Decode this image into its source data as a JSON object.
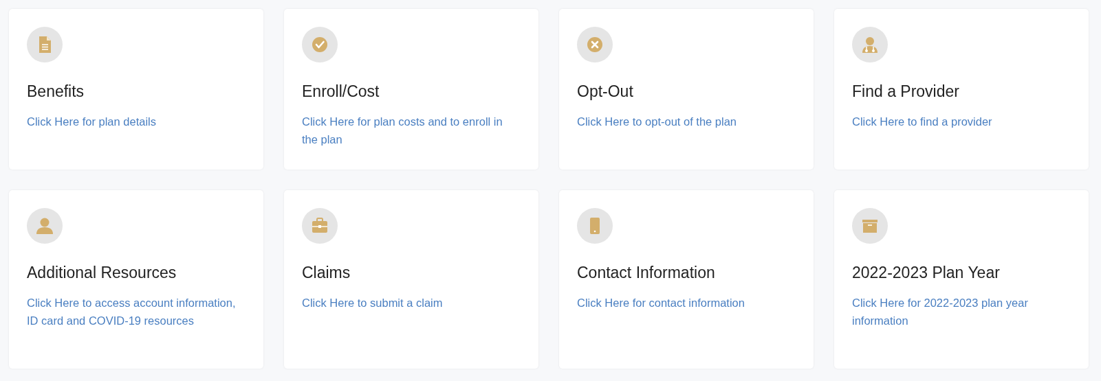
{
  "cards": [
    {
      "title": "Benefits",
      "link": "Click Here for plan details"
    },
    {
      "title": "Enroll/Cost",
      "link": "Click Here for plan costs and to enroll in the plan"
    },
    {
      "title": "Opt-Out",
      "link": "Click Here to opt-out of the plan"
    },
    {
      "title": "Find a Provider",
      "link": "Click Here to find a provider"
    },
    {
      "title": "Additional Resources",
      "link": "Click Here to access account information, ID card and COVID-19 resources"
    },
    {
      "title": "Claims",
      "link": "Click Here to submit a claim"
    },
    {
      "title": "Contact Information",
      "link": "Click Here for contact information"
    },
    {
      "title": "2022-2023 Plan Year",
      "link": "Click Here for 2022-2023 plan year information"
    }
  ]
}
